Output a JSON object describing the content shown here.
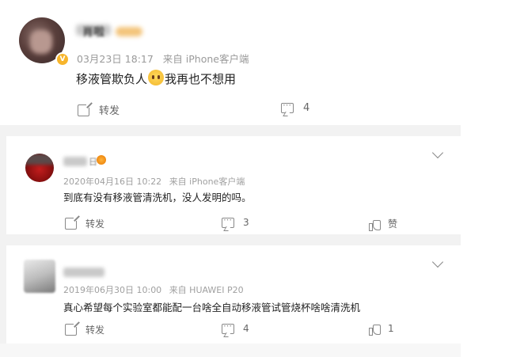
{
  "post": {
    "name": "肖啦",
    "time": "03月23日 18:17",
    "source": "来自 iPhone客户端",
    "text_before_emoji": "移液管欺负人",
    "text_after_emoji": "我再也不想用",
    "repost_label": "转发",
    "comment_count": "4"
  },
  "comments": [
    {
      "name_tag": "日",
      "time": "2020年04月16日 10:22",
      "source": "来自 iPhone客户端",
      "text": "到底有没有移液管清洗机，没人发明的吗。",
      "repost_label": "转发",
      "comment_count": "3",
      "like_label": "赞"
    },
    {
      "time": "2019年06月30日 10:00",
      "source": "来自 HUAWEI P20",
      "text": "真心希望每个实验室都能配一台啥全自动移液管试管烧杯啥啥清洗机",
      "repost_label": "转发",
      "comment_count": "4",
      "like_count": "1"
    }
  ],
  "icons": {
    "verified_badge": "verified-badge-icon",
    "vip_badge": "vip-badge-icon",
    "emoji": "crying-emoji-icon",
    "repost": "repost-icon",
    "comment": "comment-icon",
    "like": "like-icon",
    "expand": "chevron-down-icon"
  },
  "colors": {
    "text_primary": "#222222",
    "text_meta": "#9a9a9a",
    "separator": "#f2f2f2",
    "verified_gold": "#f7b52c"
  }
}
